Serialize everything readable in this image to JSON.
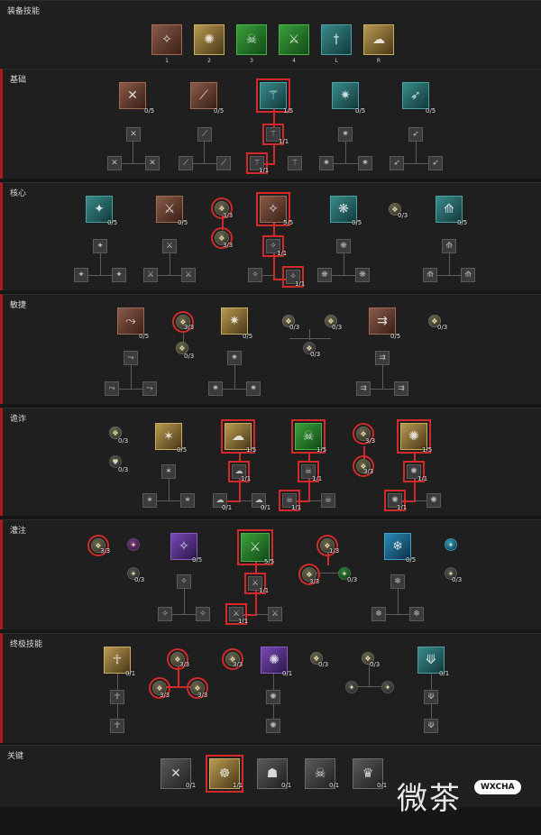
{
  "sections": {
    "equip": {
      "title": "装备技能",
      "slots": [
        "1",
        "2",
        "3",
        "4",
        "L",
        "R"
      ]
    },
    "basic": {
      "title": "基础"
    },
    "core": {
      "title": "核心"
    },
    "agility": {
      "title": "敏捷"
    },
    "subterfuge": {
      "title": "诡诈"
    },
    "imbue": {
      "title": "灌注"
    },
    "ultimate": {
      "title": "终极技能"
    },
    "key": {
      "title": "关键"
    }
  },
  "counts": {
    "b1": "0/5",
    "b2": "0/5",
    "b3": "1/5",
    "b4": "0/5",
    "b5": "0/5",
    "b3a": "1/1",
    "b3b": "1/1",
    "c1": "0/5",
    "c2": "0/5",
    "c3": "5/5",
    "c4": "0/5",
    "c5": "0/5",
    "c_p1": "3/3",
    "c_p2": "3/3",
    "c_p3": "0/3",
    "c3a": "1/1",
    "c3b": "1/1",
    "a1": "0/5",
    "a2": "0/5",
    "a3": "0/5",
    "a_p1": "3/3",
    "a_p2": "0/3",
    "a_p3": "0/3",
    "a_p4": "0/3",
    "a_p5": "0/3",
    "a_p6": "0/3",
    "s1": "0/5",
    "s2": "1/5",
    "s3": "1/5",
    "s4": "1/5",
    "s_p1": "0/3",
    "s_p2": "0/3",
    "s_p3": "3/3",
    "s_p4": "3/3",
    "s2a": "1/1",
    "s2b": "0/1",
    "s2c": "0/1",
    "s3a": "1/1",
    "s3b": "1/1",
    "s4a": "1/1",
    "s4b": "1/1",
    "i1": "0/5",
    "i2": "5/5",
    "i3": "0/5",
    "i_p1": "3/3",
    "i_p2": "0/3",
    "i_p3": "1/3",
    "i_p4": "3/3",
    "i_p5": "0/3",
    "i_p6": "0/3",
    "i2a": "1/1",
    "i2b": "1/1",
    "u1": "0/1",
    "u2": "0/1",
    "u3": "0/1",
    "u_p1": "3/3",
    "u_p2": "3/3",
    "u_p3": "3/3",
    "u_p4": "3/3",
    "u_p5": "0/3",
    "u_p6": "0/3",
    "k1": "0/1",
    "k2": "1/1",
    "k3": "0/1",
    "k4": "0/1",
    "k5": "0/1"
  },
  "watermark": {
    "text": "微茶",
    "badge": "WXCHA"
  }
}
